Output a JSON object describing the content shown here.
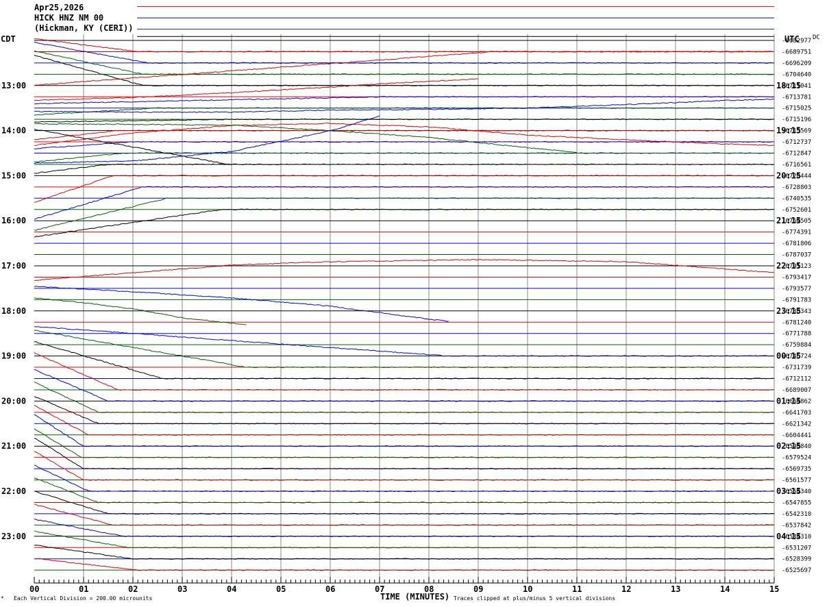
{
  "header": {
    "date": "Apr25,2026",
    "station": "HICK HNZ NM 00",
    "location": "(Hickman, KY (CERI))"
  },
  "axis": {
    "left_title": "CDT",
    "right_title": "UTC",
    "dc_label": "DC",
    "xlabel": "TIME (MINUTES)",
    "footer_scale": "Each Vertical Division =  200.00 microunits",
    "footer_clip": "Traces clipped at plus/minus 5 vertical divisions"
  },
  "chart_data": {
    "type": "line",
    "title": "Apr25,2026 HICK HNZ NM 00 (Hickman, KY (CERI))",
    "xlabel": "TIME (MINUTES)",
    "xlim": [
      0,
      15
    ],
    "x_ticks": [
      "00",
      "01",
      "02",
      "03",
      "04",
      "05",
      "06",
      "07",
      "08",
      "09",
      "10",
      "11",
      "12",
      "13",
      "14",
      "15"
    ],
    "left_time_labels": [
      {
        "row": 4,
        "label": "13:00"
      },
      {
        "row": 8,
        "label": "14:00"
      },
      {
        "row": 12,
        "label": "15:00"
      },
      {
        "row": 16,
        "label": "16:00"
      },
      {
        "row": 20,
        "label": "17:00"
      },
      {
        "row": 24,
        "label": "18:00"
      },
      {
        "row": 28,
        "label": "19:00"
      },
      {
        "row": 32,
        "label": "20:00"
      },
      {
        "row": 36,
        "label": "21:00"
      },
      {
        "row": 40,
        "label": "22:00"
      },
      {
        "row": 44,
        "label": "23:00"
      }
    ],
    "right_time_labels": [
      {
        "row": 4,
        "label": "18:15"
      },
      {
        "row": 8,
        "label": "19:15"
      },
      {
        "row": 12,
        "label": "20:15"
      },
      {
        "row": 16,
        "label": "21:15"
      },
      {
        "row": 20,
        "label": "22:15"
      },
      {
        "row": 24,
        "label": "23:15"
      },
      {
        "row": 28,
        "label": "00:15"
      },
      {
        "row": 32,
        "label": "01:15"
      },
      {
        "row": 36,
        "label": "02:15"
      },
      {
        "row": 40,
        "label": "03:15"
      },
      {
        "row": 44,
        "label": "04:15"
      }
    ],
    "dc_offsets": [
      "-6682977",
      "-6689751",
      "-6696209",
      "-6704640",
      "-6711041",
      "-6713781",
      "-6715025",
      "-6715196",
      "-6713569",
      "-6712737",
      "-6712847",
      "-6716561",
      "-6720444",
      "-6728803",
      "-6740535",
      "-6752601",
      "-6764505",
      "-6774391",
      "-6781806",
      "-6787037",
      "-6791123",
      "-6793417",
      "-6793577",
      "-6791783",
      "-6788343",
      "-6781240",
      "-6771788",
      "-6759884",
      "-6746724",
      "-6731739",
      "-6712112",
      "-6689007",
      "-6664862",
      "-6641703",
      "-6621342",
      "-6604441",
      "-6590840",
      "-6579524",
      "-6569735",
      "-6561577",
      "-6554340",
      "-6547855",
      "-6542310",
      "-6537842",
      "-6534310",
      "-6531207",
      "-6528399",
      "-6525697"
    ],
    "trace_colors": [
      "#000000",
      "#e00000",
      "#0000e0",
      "#006000"
    ],
    "trace_shapes": [
      {
        "row": 1,
        "color": "#e00000",
        "start": [
          0,
          -1.9
        ],
        "bend": [
          2.1,
          0
        ],
        "end": [
          15,
          0
        ]
      },
      {
        "row": 2,
        "color": "#0000e0",
        "start": [
          0,
          -3.0
        ],
        "bend": [
          2.3,
          0
        ],
        "end": [
          15,
          0
        ]
      },
      {
        "row": 3,
        "color": "#006000",
        "start": [
          0,
          -3.4
        ],
        "bend": [
          2.2,
          0
        ],
        "end": [
          15,
          0
        ]
      },
      {
        "row": 4,
        "color": "#000000",
        "start": [
          0,
          -4.4
        ],
        "bend": [
          2.2,
          0
        ],
        "end": [
          15,
          0
        ]
      },
      {
        "row": 1,
        "color": "#e00000",
        "start": [
          0,
          4.9
        ],
        "bend": [
          9.3,
          0
        ],
        "end": [
          15,
          0
        ]
      },
      {
        "row": 5,
        "color": "#0000e0",
        "start": [
          0,
          1.0
        ],
        "bend": [
          7.1,
          0
        ],
        "end": [
          15,
          0
        ]
      },
      {
        "row": 6,
        "color": "#006000",
        "start": [
          0,
          1.0
        ],
        "bend": [
          2.5,
          0
        ],
        "end": [
          15,
          0
        ]
      },
      {
        "row": 7,
        "color": "#000000",
        "start": [
          0,
          0.4
        ],
        "bend": [
          4.0,
          0
        ],
        "end": [
          15,
          0
        ]
      },
      {
        "row": 8,
        "color": "#e00000",
        "start": [
          0,
          1.3
        ],
        "bend": [
          1.7,
          0
        ],
        "end": [
          15,
          0
        ]
      },
      {
        "row": 9,
        "color": "#0000e0",
        "start": [
          0,
          1.0
        ],
        "bend": [
          2.0,
          0
        ],
        "end": [
          15,
          0
        ]
      },
      {
        "row": 10,
        "color": "#006000",
        "start": [
          0,
          1.3
        ],
        "bend": [
          1.8,
          0
        ],
        "end": [
          15,
          0
        ]
      },
      {
        "row": 11,
        "color": "#000000",
        "start": [
          0,
          1.3
        ],
        "bend": [
          1.5,
          0
        ],
        "end": [
          15,
          0
        ]
      },
      {
        "row": 12,
        "color": "#e00000",
        "start": [
          0,
          3.9
        ],
        "bend": [
          1.6,
          0
        ],
        "end": [
          15,
          0
        ]
      },
      {
        "row": 13,
        "color": "#0000e0",
        "start": [
          0,
          4.7
        ],
        "bend": [
          2.2,
          0
        ],
        "end": [
          15,
          0
        ]
      },
      {
        "row": 14,
        "color": "#006000",
        "start": [
          0,
          4.7
        ],
        "bend": [
          2.7,
          0
        ],
        "end": [
          15,
          0
        ]
      },
      {
        "row": 15,
        "color": "#000000",
        "start": [
          0,
          4.0
        ],
        "bend": [
          3.8,
          0
        ],
        "end": [
          15,
          0
        ]
      },
      {
        "row": 28,
        "color": "#0000e0",
        "start": [
          0,
          -4.3
        ],
        "bend": [
          8.4,
          0
        ],
        "end": [
          15,
          0
        ]
      },
      {
        "row": 29,
        "color": "#006000",
        "start": [
          0,
          -5.4
        ],
        "bend": [
          4.3,
          0
        ],
        "end": [
          15,
          0
        ]
      },
      {
        "row": 30,
        "color": "#000000",
        "start": [
          0,
          -5.4
        ],
        "bend": [
          2.6,
          0
        ],
        "end": [
          15,
          0
        ]
      },
      {
        "row": 31,
        "color": "#e00000",
        "start": [
          0,
          -5.4
        ],
        "bend": [
          1.7,
          0
        ],
        "end": [
          15,
          0
        ]
      },
      {
        "row": 32,
        "color": "#0000e0",
        "start": [
          0,
          -4.6
        ],
        "bend": [
          1.5,
          0
        ],
        "end": [
          15,
          0
        ]
      },
      {
        "row": 33,
        "color": "#006000",
        "start": [
          0,
          -4.4
        ],
        "bend": [
          1.3,
          0
        ],
        "end": [
          15,
          0
        ]
      },
      {
        "row": 34,
        "color": "#000000",
        "start": [
          0,
          -4.0
        ],
        "bend": [
          1.3,
          0
        ],
        "end": [
          15,
          0
        ]
      },
      {
        "row": 35,
        "color": "#e00000",
        "start": [
          0,
          -4.3
        ],
        "bend": [
          1.1,
          0
        ],
        "end": [
          15,
          0
        ]
      },
      {
        "row": 36,
        "color": "#0000e0",
        "start": [
          0,
          -4.6
        ],
        "bend": [
          1.0,
          0
        ],
        "end": [
          15,
          0
        ]
      },
      {
        "row": 37,
        "color": "#006000",
        "start": [
          0,
          -4.2
        ],
        "bend": [
          0.95,
          0
        ],
        "end": [
          15,
          0
        ]
      },
      {
        "row": 38,
        "color": "#000000",
        "start": [
          0,
          -4.5
        ],
        "bend": [
          1.0,
          0
        ],
        "end": [
          15,
          0
        ]
      },
      {
        "row": 39,
        "color": "#e00000",
        "start": [
          0,
          -4.2
        ],
        "bend": [
          1.0,
          0
        ],
        "end": [
          15,
          0
        ]
      },
      {
        "row": 40,
        "color": "#0000e0",
        "start": [
          0,
          -3.8
        ],
        "bend": [
          1.1,
          0
        ],
        "end": [
          15,
          0
        ]
      },
      {
        "row": 41,
        "color": "#006000",
        "start": [
          0,
          -3.6
        ],
        "bend": [
          1.3,
          0
        ],
        "end": [
          15,
          0
        ]
      },
      {
        "row": 42,
        "color": "#000000",
        "start": [
          0,
          -3.3
        ],
        "bend": [
          1.5,
          0
        ],
        "end": [
          15,
          0
        ]
      },
      {
        "row": 43,
        "color": "#e00000",
        "start": [
          0,
          -3.0
        ],
        "bend": [
          1.6,
          0
        ],
        "end": [
          15,
          0
        ]
      },
      {
        "row": 44,
        "color": "#0000e0",
        "start": [
          0,
          -2.5
        ],
        "bend": [
          1.8,
          0
        ],
        "end": [
          15,
          0
        ]
      },
      {
        "row": 45,
        "color": "#006000",
        "start": [
          0,
          -2.4
        ],
        "bend": [
          1.9,
          0
        ],
        "end": [
          15,
          0
        ]
      },
      {
        "row": 46,
        "color": "#000000",
        "start": [
          0,
          -2.0
        ],
        "bend": [
          2.0,
          0
        ],
        "end": [
          15,
          0
        ]
      },
      {
        "row": 47,
        "color": "#e00000",
        "start": [
          0,
          -1.7
        ],
        "bend": [
          2.1,
          0
        ],
        "end": [
          15,
          0
        ]
      }
    ],
    "long_drift_traces": [
      {
        "row": 5,
        "color": "#e00000",
        "points": [
          [
            0,
            0.5
          ],
          [
            2,
            0.1
          ],
          [
            4,
            -0.6
          ],
          [
            6,
            -1.4
          ],
          [
            7,
            -1.9
          ],
          [
            9,
            -2.6
          ]
        ]
      },
      {
        "row": 6,
        "color": "#0000e0",
        "points": [
          [
            0,
            0.5
          ],
          [
            2,
            0.6
          ],
          [
            4,
            0.6
          ],
          [
            6,
            0.3
          ],
          [
            8,
            0.2
          ],
          [
            10,
            0
          ],
          [
            12,
            -0.5
          ],
          [
            14,
            -1.1
          ],
          [
            15,
            -1.3
          ]
        ]
      },
      {
        "row": 7,
        "color": "#e00000",
        "points": [
          [
            0,
            3.8
          ],
          [
            2,
            2.0
          ],
          [
            4,
            0.9
          ],
          [
            6,
            0.6
          ],
          [
            8,
            1.1
          ],
          [
            10,
            2.3
          ],
          [
            12,
            3.0
          ],
          [
            14,
            3.6
          ],
          [
            15,
            3.8
          ]
        ]
      },
      {
        "row": 8,
        "color": "#006000",
        "points": [
          [
            0,
            -1.0
          ],
          [
            4,
            -0.8
          ],
          [
            6,
            0
          ],
          [
            8,
            1.0
          ],
          [
            10,
            2.5
          ],
          [
            11,
            3.2
          ]
        ]
      },
      {
        "row": 8,
        "color": "#000000",
        "points": [
          [
            0,
            -0.2
          ],
          [
            2,
            2.4
          ],
          [
            4,
            5.0
          ]
        ]
      },
      {
        "row": 9,
        "color": "#0000e0",
        "points": [
          [
            0,
            3.1
          ],
          [
            2,
            2.8
          ],
          [
            4,
            1.4
          ],
          [
            6,
            -1.6
          ],
          [
            7,
            -3.8
          ]
        ]
      },
      {
        "row": 20,
        "color": "#e00000",
        "points": [
          [
            0,
            2.1
          ],
          [
            2,
            1.0
          ],
          [
            4,
            -0.1
          ],
          [
            6,
            -0.6
          ],
          [
            9,
            -0.9
          ],
          [
            12,
            -0.6
          ],
          [
            15,
            1.0
          ]
        ]
      },
      {
        "row": 22,
        "color": "#0000e0",
        "points": [
          [
            0,
            -0.3
          ],
          [
            2,
            0.5
          ],
          [
            4,
            1.4
          ],
          [
            6,
            2.6
          ],
          [
            8,
            4.5
          ],
          [
            8.4,
            4.8
          ]
        ]
      },
      {
        "row": 22,
        "color": "#006000",
        "points": [
          [
            0,
            1.4
          ],
          [
            1,
            2.1
          ],
          [
            2,
            3.0
          ],
          [
            3,
            4.3
          ],
          [
            4.3,
            5.3
          ]
        ]
      }
    ]
  }
}
